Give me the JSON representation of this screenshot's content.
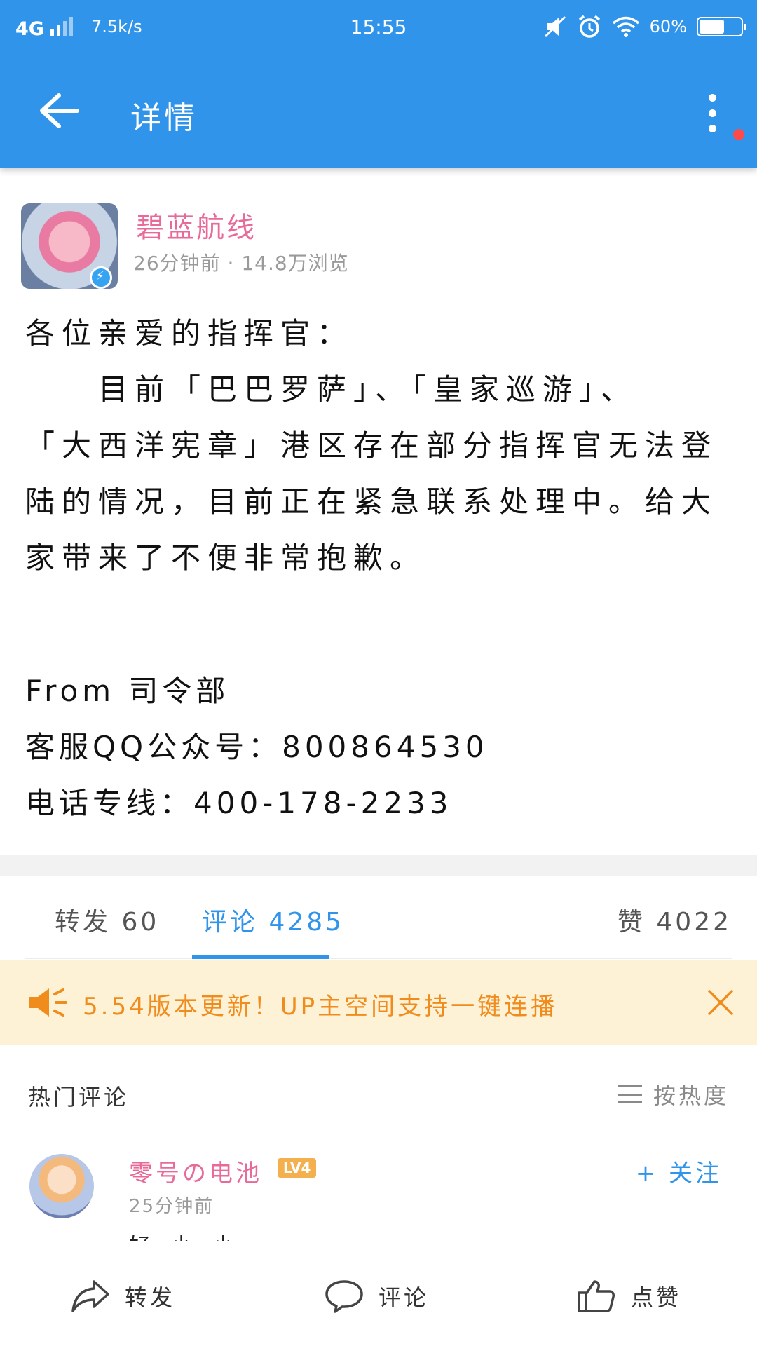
{
  "status_bar": {
    "network": "4G",
    "speed": "7.5k/s",
    "time": "15:55",
    "battery": "60%",
    "battery_level": 0.6
  },
  "app_bar": {
    "title": "详情"
  },
  "author": {
    "name": "碧蓝航线",
    "meta": "26分钟前 · 14.8万浏览"
  },
  "post": {
    "lines": [
      "各位亲爱的指挥官：",
      "　　目前「巴巴罗萨」、「皇家巡游」、",
      "「大西洋宪章」港区存在部分指挥官无法登",
      "陆的情况，目前正在紧急联系处理中。给大",
      "家带来了不便非常抱歉。"
    ],
    "signature": [
      "From 司令部",
      "客服QQ公众号：800864530",
      "电话专线：400-178-2233"
    ]
  },
  "tabs": {
    "repost": "转发 60",
    "comments": "评论 4285",
    "likes": "赞 4022"
  },
  "notice": {
    "text": "5.54版本更新！UP主空间支持一键连播"
  },
  "hot_comments": {
    "heading": "热门评论",
    "sort_label": "按热度"
  },
  "comment": {
    "user": "零号の电池",
    "level": "LV4",
    "time": "25分钟前",
    "text": "好 小 小",
    "follow": "+ 关注"
  },
  "bottom_bar": {
    "repost": "转发",
    "comment": "评论",
    "like": "点赞"
  },
  "colors": {
    "primary": "#2f94ea",
    "author_pink": "#e86a98",
    "notice_orange": "#f08c1c",
    "notice_bg": "#fdf1d6"
  }
}
